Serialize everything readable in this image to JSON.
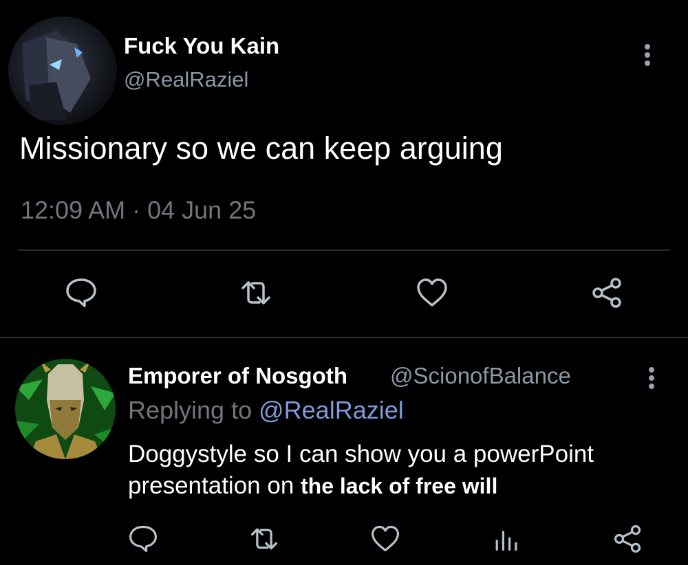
{
  "tweet": {
    "author": {
      "display_name": "Fuck You Kain",
      "handle": "@RealRaziel",
      "avatar_icon": "raziel-avatar-icon"
    },
    "text": "Missionary so we can keep arguing",
    "timestamp": "12:09 AM · 04 Jun 25",
    "actions": [
      "reply-icon",
      "retweet-icon",
      "like-icon",
      "share-icon"
    ]
  },
  "reply": {
    "author": {
      "display_name": "Emporer of Nosgoth",
      "handle": "@ScionofBalance",
      "avatar_icon": "kain-avatar-icon"
    },
    "replying_prefix": "Replying to ",
    "replying_to": "@RealRaziel",
    "text_regular": "Doggystyle so I can show you a powerPoint presentation on ",
    "text_bold": "the lack of free will",
    "actions": [
      "reply-icon",
      "retweet-icon",
      "like-icon",
      "analytics-icon",
      "share-icon"
    ]
  },
  "colors": {
    "background": "#000000",
    "primary_text": "#ffffff",
    "secondary_text": "#8b98a5",
    "muted_text": "#71767b",
    "mention": "#7d9bd8",
    "divider": "#2f3336"
  }
}
